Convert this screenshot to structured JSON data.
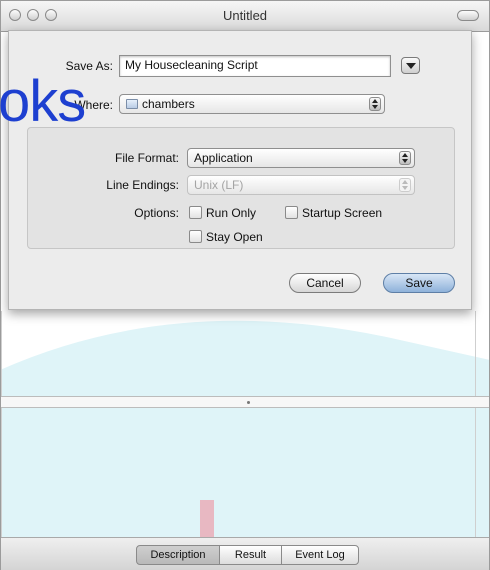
{
  "window": {
    "title": "Untitled"
  },
  "overlay": {
    "text": "oks"
  },
  "sheet": {
    "save_as_label": "Save As:",
    "save_as_value": "My Housecleaning Script",
    "where_label": "Where:",
    "where_value": "chambers",
    "file_format_label": "File Format:",
    "file_format_value": "Application",
    "line_endings_label": "Line Endings:",
    "line_endings_value": "Unix (LF)",
    "options_label": "Options:",
    "options": {
      "run_only": "Run Only",
      "startup_screen": "Startup Screen",
      "stay_open": "Stay Open"
    },
    "cancel_label": "Cancel",
    "save_label": "Save"
  },
  "bottom_tabs": [
    "Description",
    "Result",
    "Event Log"
  ],
  "colors": {
    "default_button": "#8fb2da",
    "background_shape": "#dff4f8",
    "overlay_text": "#1d3fd0"
  }
}
